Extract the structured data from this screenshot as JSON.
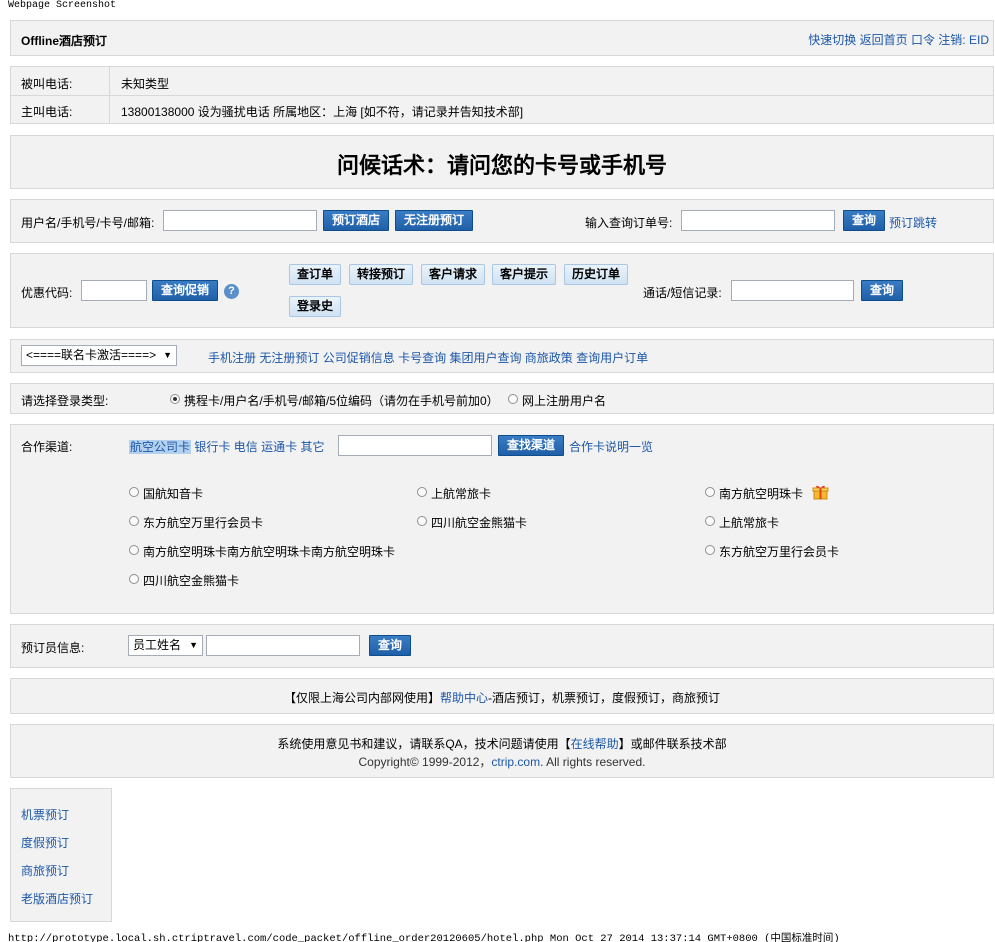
{
  "screenshot_caption": "Webpage Screenshot",
  "header": {
    "title": "Offline酒店预订",
    "links": [
      "快速切换",
      "返回首页",
      "口令",
      "注销:",
      "EID"
    ]
  },
  "call_info": {
    "called_label": "被叫电话:",
    "called_value": "未知类型",
    "caller_label": "主叫电话:",
    "caller_value": "13800138000 设为骚扰电话 所属地区：上海 [如不符，请记录并告知技术部]"
  },
  "greeting": "问候话术：请问您的卡号或手机号",
  "search": {
    "user_label": "用户名/手机号/卡号/邮箱:",
    "book_hotel": "预订酒店",
    "unregistered_book": "无注册预订",
    "order_label": "输入查询订单号:",
    "query": "查询",
    "jump": "预订跳转"
  },
  "promo": {
    "label": "优惠代码:",
    "query_promo": "查询促销",
    "help_icon": "?",
    "buttons": [
      "查订单",
      "转接预订",
      "客户请求",
      "客户提示",
      "历史订单",
      "登录史"
    ],
    "call_label": "通话/短信记录:",
    "query": "查询"
  },
  "member": {
    "select": "<====联名卡激活====>",
    "links": [
      "手机注册",
      "无注册预订",
      "公司促销信息",
      "卡号查询",
      "集团用户查询",
      "商旅政策",
      "查询用户订单"
    ]
  },
  "login_type": {
    "label": "请选择登录类型:",
    "opt1": "携程卡/用户名/手机号/邮箱/5位编码（请勿在手机号前加0）",
    "opt2": "网上注册用户名"
  },
  "channel": {
    "label": "合作渠道:",
    "tabs": [
      "航空公司卡",
      "银行卡",
      "电信",
      "运通卡",
      "其它"
    ],
    "find": "查找渠道",
    "explain": "合作卡说明一览",
    "cards": {
      "r1c1": "国航知音卡",
      "r1c2": "上航常旅卡",
      "r1c3": "南方航空明珠卡",
      "r2c1": "东方航空万里行会员卡",
      "r2c2": "四川航空金熊猫卡",
      "r2c3": "上航常旅卡",
      "r3c1": "南方航空明珠卡南方航空明珠卡南方航空明珠卡",
      "r3c3": "东方航空万里行会员卡",
      "r4c1": "四川航空金熊猫卡"
    }
  },
  "agent": {
    "label": "预订员信息:",
    "select": "员工姓名",
    "query": "查询"
  },
  "notice": {
    "prefix": "【仅限上海公司内部网使用】",
    "help": "帮助中心",
    "suffix": "-酒店预订，机票预订，度假预订，商旅预订"
  },
  "footer": {
    "line1_a": "系统使用意见书和建议，请联系QA，技术问题请使用【",
    "line1_link": "在线帮助",
    "line1_b": "】或邮件联系技术部",
    "copyright_a": "Copyright© 1999-2012，",
    "copyright_link": "ctrip.com",
    "copyright_b": ". All rights reserved."
  },
  "side_links": [
    "机票预订",
    "度假预订",
    "商旅预订",
    "老版酒店预订"
  ],
  "status_bar": "http://prototype.local.sh.ctriptravel.com/code_packet/offline_order20120605/hotel.php Mon Oct 27 2014 13:37:14 GMT+0800 (中国标准时间)"
}
